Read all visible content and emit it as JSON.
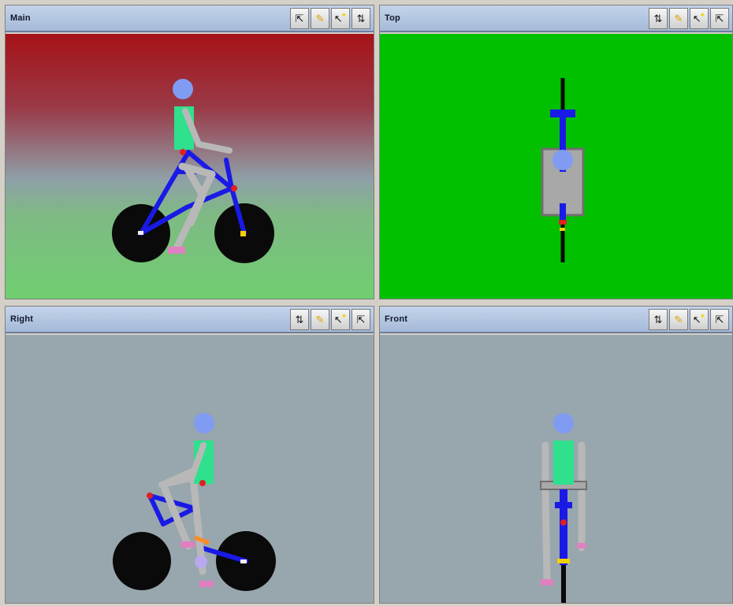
{
  "panes": {
    "main": {
      "title": "Main"
    },
    "top": {
      "title": "Top"
    },
    "right": {
      "title": "Right"
    },
    "front": {
      "title": "Front"
    }
  },
  "toolbar": {
    "icons": [
      "pan-updown-icon",
      "pencil-icon",
      "select-pointer-icon",
      "cursor-tool-icon"
    ],
    "glyphs": {
      "pan": "⇅",
      "pencil": "✎",
      "pointer": "↖",
      "star": "✦",
      "cursor": "⇱"
    }
  },
  "colors": {
    "frame_blue": "#1a1ae6",
    "torso_green": "#2fe08c",
    "head_blue": "#7f9cf2",
    "limb_gray": "#b8b8b8",
    "wheel_black": "#0a0a0a",
    "joint_red": "#e02020",
    "shoe_pink": "#e080c0",
    "top_bg": "#00c000",
    "side_bg": "#98a6ad"
  }
}
